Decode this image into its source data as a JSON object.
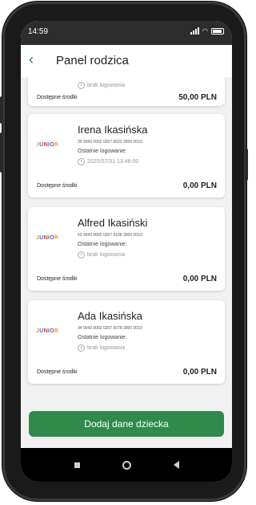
{
  "status": {
    "time": "14:59"
  },
  "header": {
    "back_icon": "chevron-left-icon",
    "title": "Panel rodzica"
  },
  "partial_card": {
    "login_value": "brak logowania",
    "funds_label": "Dostępne środki",
    "funds_value": "50,00 PLN"
  },
  "children": [
    {
      "name": "Irena Ikasińska",
      "account": "39 9043 0002 0207 6023 3000 0010",
      "login_label": "Ostatnie logowanie:",
      "login_value": "2025/07/31 13:48:00",
      "funds_label": "Dostępne środki",
      "funds_value": "0,00 PLN"
    },
    {
      "name": "Alfred Ikasiński",
      "account": "53 9043 0002 0207 6108 3000 0010",
      "login_label": "Ostatnie logowanie:",
      "login_value": "brak logowania",
      "funds_label": "Dostępne środki",
      "funds_value": "0,00 PLN"
    },
    {
      "name": "Ada Ikasińska",
      "account": "34 9043 0002 0207 6078 3000 0010",
      "login_label": "Ostatnie logowanie:",
      "login_value": "brak logowania",
      "funds_label": "Dostępne środki",
      "funds_value": "0,00 PLN"
    }
  ],
  "junior_logo": [
    "J",
    "U",
    "N",
    "I",
    "O",
    "R"
  ],
  "add_button": {
    "label": "Dodaj dane dziecka"
  },
  "colors": {
    "accent": "#2f8a4c",
    "statusbar": "#2d2d2d",
    "background": "#f1f1f1"
  }
}
